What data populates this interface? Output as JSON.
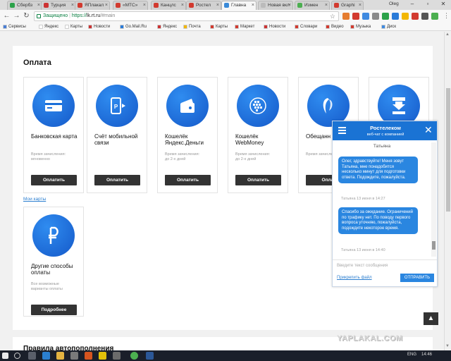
{
  "browser": {
    "tabs": [
      {
        "label": "Сбербз",
        "color": "#2ca24a"
      },
      {
        "label": "Турция",
        "color": "#cc3333"
      },
      {
        "label": "ЯПлакал",
        "color": "#d23a2f"
      },
      {
        "label": "«МТС»",
        "color": "#d23a2f"
      },
      {
        "label": "Канцлс",
        "color": "#d23a2f"
      },
      {
        "label": "Ростел",
        "color": "#d23a2f"
      },
      {
        "label": "Главна",
        "color": "#3a8ad8"
      },
      {
        "label": "Новая вкл",
        "color": "#bbbbbb"
      },
      {
        "label": "Измен",
        "color": "#4caf50"
      },
      {
        "label": "Graphi",
        "color": "#d23a2f"
      }
    ],
    "profile_name": "Oleg",
    "window_controls": [
      "–",
      "▫",
      "✕"
    ],
    "address": {
      "secure_label": "Защищено",
      "url_prefix": "https://",
      "url_host": "lk.rt.ru",
      "url_path": "/#main"
    },
    "bookmarks": [
      {
        "label": "Сервисы",
        "color": "#4a7fd6"
      },
      {
        "label": "Яндекс",
        "color": "#ffffff"
      },
      {
        "label": "Карты",
        "color": "#ffffff"
      },
      {
        "label": "Новости",
        "color": "#cc3333"
      },
      {
        "label": "Go.Mail.Ru",
        "color": "#2a7bd8"
      },
      {
        "label": "Яндекс",
        "color": "#cc3333"
      },
      {
        "label": "Почта",
        "color": "#f2b600"
      },
      {
        "label": "Карты",
        "color": "#d23a2f"
      },
      {
        "label": "Маркет",
        "color": "#d23a2f"
      },
      {
        "label": "Новости",
        "color": "#cc3333"
      },
      {
        "label": "Словари",
        "color": "#d23a2f"
      },
      {
        "label": "Видео",
        "color": "#d23a2f"
      },
      {
        "label": "Музыка",
        "color": "#d23a2f"
      },
      {
        "label": "Диск",
        "color": "#3f8ae0"
      }
    ]
  },
  "page": {
    "section_title": "Оплата",
    "payment_methods": [
      {
        "name": "Банковская карта",
        "meta": "Время зачисления:\nмгновенно",
        "button": "Оплатить",
        "icon": "card-icon"
      },
      {
        "name": "Счёт мобильной связи",
        "meta": "",
        "button": "Оплатить",
        "icon": "phone-pay-icon"
      },
      {
        "name": "Кошелёк Яндекс.Деньги",
        "meta": "Время зачисления:\nдо 2-х дней",
        "button": "Оплатить",
        "icon": "wallet-icon"
      },
      {
        "name": "Кошелёк WebMoney",
        "meta": "Время зачисления:\nдо 2-х дней",
        "button": "Оплатить",
        "icon": "webmoney-icon"
      },
      {
        "name": "Обещанн платёж",
        "meta": "Время зачисления",
        "button": "Оплат",
        "icon": "rostelecom-icon"
      },
      {
        "name": "",
        "meta": "",
        "button": "",
        "icon": "autopay-icon"
      }
    ],
    "my_cards_link": "Мои карты",
    "other_method": {
      "name": "Другие способы оплаты",
      "meta": "Все возможные\nварианты оплаты",
      "button": "Подробнее",
      "icon": "ruble-icon"
    },
    "rules_title": "Правила автопополнения",
    "accent_color": "#1a6fd9"
  },
  "chat": {
    "title": "Ростелеком",
    "subtitle": "веб-чат с компанией",
    "agent_name": "Татьяна",
    "messages": [
      {
        "text": "Олег, здравствуйте! Меня зовут Татьяна, мне понадобится несколько минут для подготовки ответа. Подождите, пожалуйста.",
        "time": "Татьяна 13 июня в 14:27"
      },
      {
        "text": "Спасибо за ожидание. Ограничений по трафику нет. По поводу первого вопроса уточняю, пожалуйста, подождите некоторое время.",
        "time": "Татьяна 13 июня в 14:40"
      }
    ],
    "input_placeholder": "Введите текст сообщения",
    "attach_label": "Прикрепить файл",
    "send_label": "ОТПРАВИТЬ"
  },
  "watermark": "YAPLAKAL.COM",
  "taskbar": {
    "language": "ENG",
    "time": "14:46"
  }
}
